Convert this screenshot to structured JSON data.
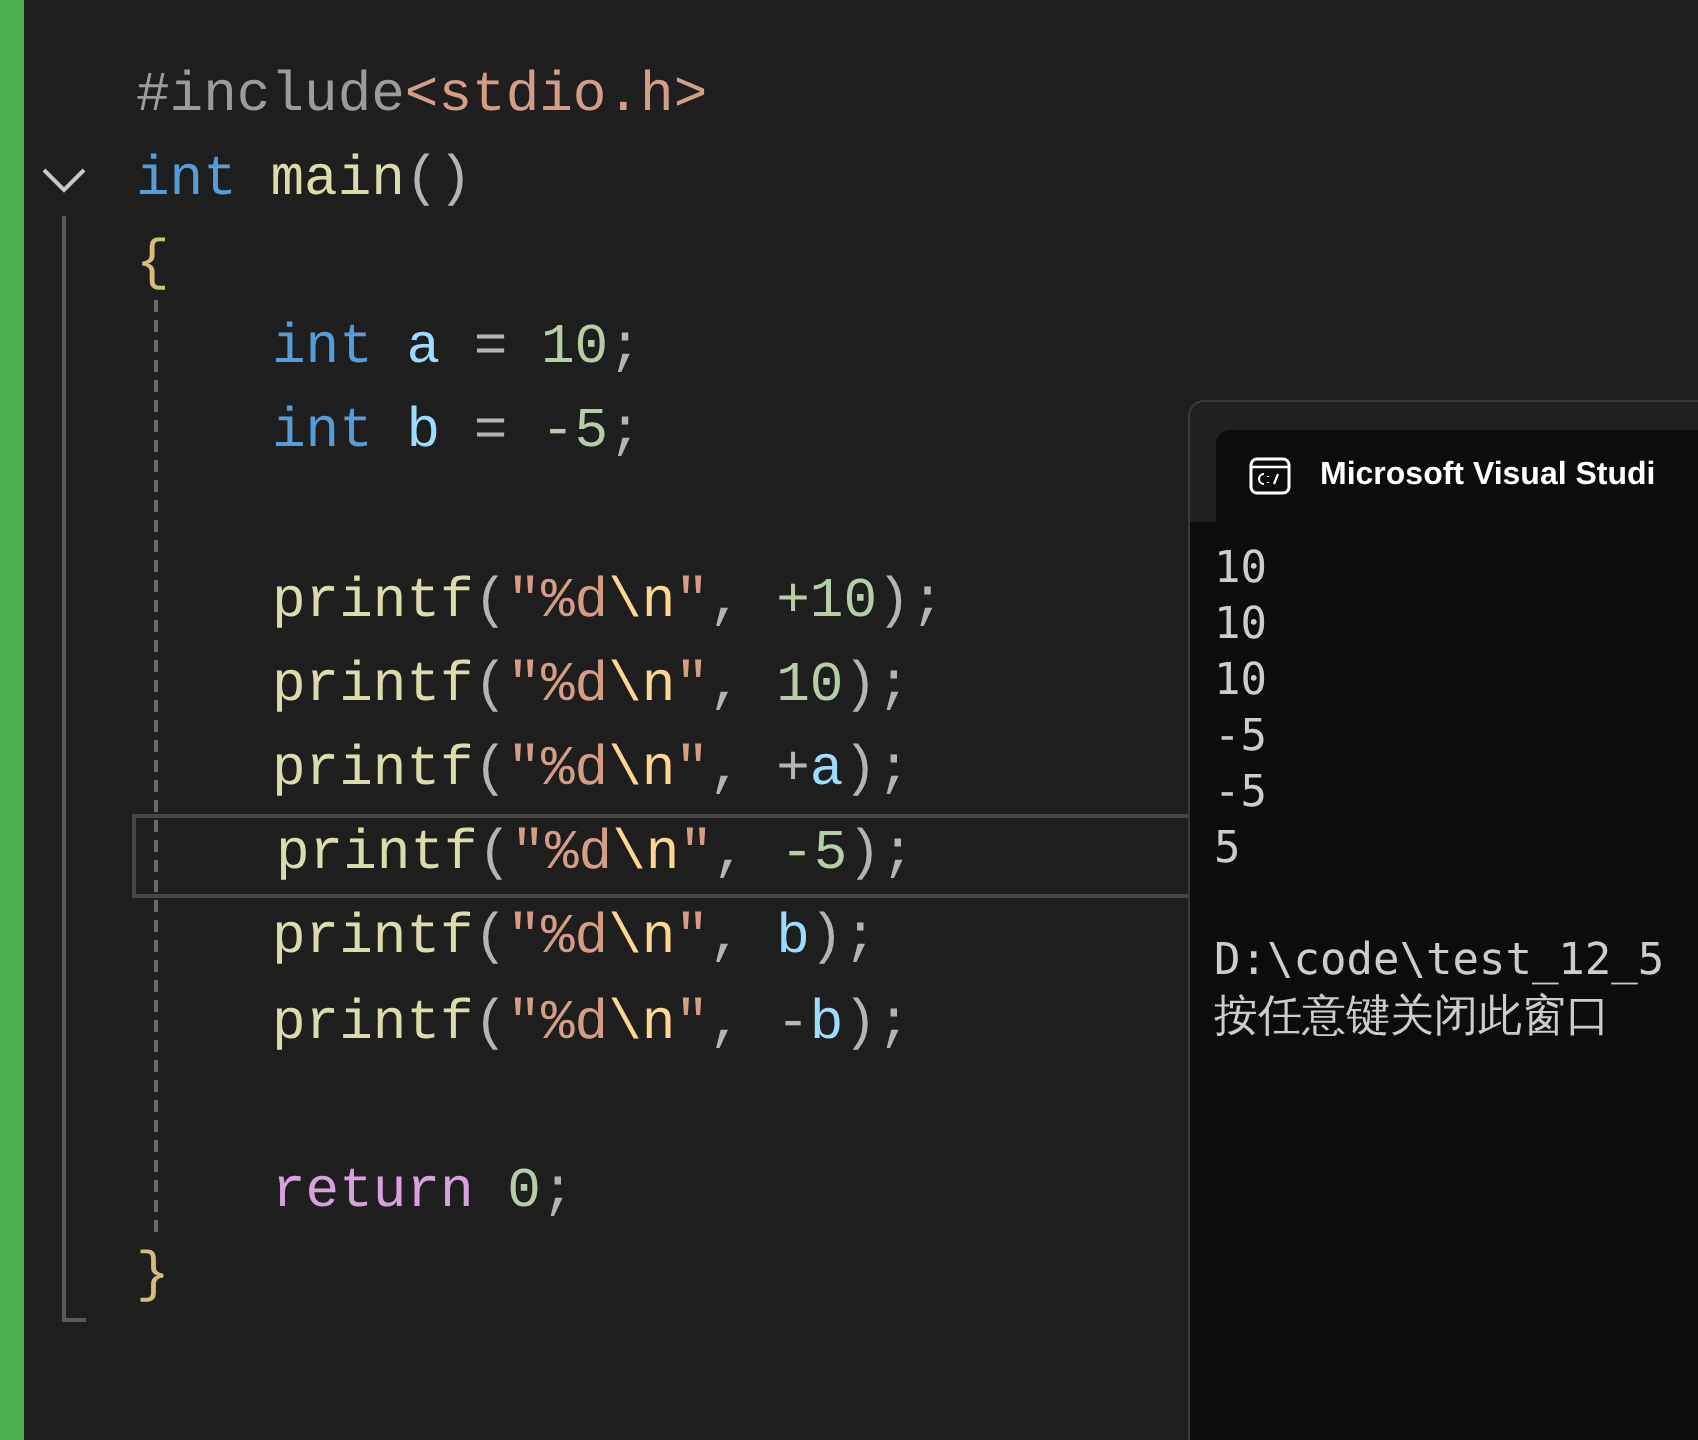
{
  "editor": {
    "lines": [
      {
        "kind": "code",
        "current": false,
        "tokens": [
          {
            "text": "#include",
            "kind": "pre"
          },
          {
            "text": "<stdio.h>",
            "kind": "str"
          }
        ]
      },
      {
        "kind": "foldable",
        "expanded": true,
        "current": false,
        "tokens": [
          {
            "text": "int",
            "kind": "keyword"
          },
          {
            "text": " main",
            "kind": "func"
          },
          {
            "text": "()",
            "kind": "punct"
          }
        ],
        "children": [
          {
            "kind": "code",
            "current": false,
            "tokens": [
              {
                "text": "{",
                "kind": "brace"
              }
            ],
            "children": [
              {
                "kind": "code",
                "current": false,
                "tokens": [
                  {
                    "text": "int",
                    "kind": "keyword"
                  },
                  {
                    "text": " a",
                    "kind": "var"
                  },
                  {
                    "text": " = ",
                    "kind": "punct"
                  },
                  {
                    "text": "10",
                    "kind": "num"
                  },
                  {
                    "text": ";",
                    "kind": "punct"
                  }
                ]
              },
              {
                "kind": "code",
                "current": false,
                "tokens": [
                  {
                    "text": "int",
                    "kind": "keyword"
                  },
                  {
                    "text": " b",
                    "kind": "var"
                  },
                  {
                    "text": " = ",
                    "kind": "punct"
                  },
                  {
                    "text": "-5",
                    "kind": "num"
                  },
                  {
                    "text": ";",
                    "kind": "punct"
                  }
                ]
              },
              {
                "kind": "blank",
                "current": false
              },
              {
                "kind": "code",
                "current": false,
                "tokens": [
                  {
                    "text": "printf",
                    "kind": "func"
                  },
                  {
                    "text": "(",
                    "kind": "punct"
                  },
                  {
                    "text": "\"%d",
                    "kind": "str"
                  },
                  {
                    "text": "\\n",
                    "kind": "esc"
                  },
                  {
                    "text": "\"",
                    "kind": "str"
                  },
                  {
                    "text": ", ",
                    "kind": "punct"
                  },
                  {
                    "text": "+10",
                    "kind": "num"
                  },
                  {
                    "text": ");",
                    "kind": "punct"
                  }
                ]
              },
              {
                "kind": "code",
                "current": false,
                "tokens": [
                  {
                    "text": "printf",
                    "kind": "func"
                  },
                  {
                    "text": "(",
                    "kind": "punct"
                  },
                  {
                    "text": "\"%d",
                    "kind": "str"
                  },
                  {
                    "text": "\\n",
                    "kind": "esc"
                  },
                  {
                    "text": "\"",
                    "kind": "str"
                  },
                  {
                    "text": ", ",
                    "kind": "punct"
                  },
                  {
                    "text": "10",
                    "kind": "num"
                  },
                  {
                    "text": ");",
                    "kind": "punct"
                  }
                ]
              },
              {
                "kind": "code",
                "current": false,
                "tokens": [
                  {
                    "text": "printf",
                    "kind": "func"
                  },
                  {
                    "text": "(",
                    "kind": "punct"
                  },
                  {
                    "text": "\"%d",
                    "kind": "str"
                  },
                  {
                    "text": "\\n",
                    "kind": "esc"
                  },
                  {
                    "text": "\"",
                    "kind": "str"
                  },
                  {
                    "text": ", +",
                    "kind": "punct"
                  },
                  {
                    "text": "a",
                    "kind": "var"
                  },
                  {
                    "text": ");",
                    "kind": "punct"
                  }
                ]
              },
              {
                "kind": "code",
                "current": true,
                "tokens": [
                  {
                    "text": "printf",
                    "kind": "func"
                  },
                  {
                    "text": "(",
                    "kind": "punct"
                  },
                  {
                    "text": "\"%d",
                    "kind": "str"
                  },
                  {
                    "text": "\\n",
                    "kind": "esc"
                  },
                  {
                    "text": "\"",
                    "kind": "str"
                  },
                  {
                    "text": ", ",
                    "kind": "punct"
                  },
                  {
                    "text": "-5",
                    "kind": "num"
                  },
                  {
                    "text": ");",
                    "kind": "punct"
                  }
                ]
              },
              {
                "kind": "code",
                "current": false,
                "tokens": [
                  {
                    "text": "printf",
                    "kind": "func"
                  },
                  {
                    "text": "(",
                    "kind": "punct"
                  },
                  {
                    "text": "\"%d",
                    "kind": "str"
                  },
                  {
                    "text": "\\n",
                    "kind": "esc"
                  },
                  {
                    "text": "\"",
                    "kind": "str"
                  },
                  {
                    "text": ", ",
                    "kind": "punct"
                  },
                  {
                    "text": "b",
                    "kind": "var"
                  },
                  {
                    "text": ");",
                    "kind": "punct"
                  }
                ]
              },
              {
                "kind": "code",
                "current": false,
                "tokens": [
                  {
                    "text": "printf",
                    "kind": "func"
                  },
                  {
                    "text": "(",
                    "kind": "punct"
                  },
                  {
                    "text": "\"%d",
                    "kind": "str"
                  },
                  {
                    "text": "\\n",
                    "kind": "esc"
                  },
                  {
                    "text": "\"",
                    "kind": "str"
                  },
                  {
                    "text": ", -",
                    "kind": "punct"
                  },
                  {
                    "text": "b",
                    "kind": "var"
                  },
                  {
                    "text": ");",
                    "kind": "punct"
                  }
                ]
              },
              {
                "kind": "blank",
                "current": false
              },
              {
                "kind": "code",
                "current": false,
                "tokens": [
                  {
                    "text": "return",
                    "kind": "control"
                  },
                  {
                    "text": " 0",
                    "kind": "num"
                  },
                  {
                    "text": ";",
                    "kind": "punct"
                  }
                ]
              }
            ]
          },
          {
            "kind": "code",
            "current": false,
            "tokens": [
              {
                "text": "}",
                "kind": "brace"
              }
            ]
          }
        ]
      }
    ]
  },
  "console": {
    "title": "Microsoft Visual Studi",
    "output": [
      "10",
      "10",
      "10",
      "-5",
      "-5",
      "5"
    ],
    "prompt": [
      "D:\\code\\test_12_5",
      "按任意键关闭此窗口"
    ]
  }
}
